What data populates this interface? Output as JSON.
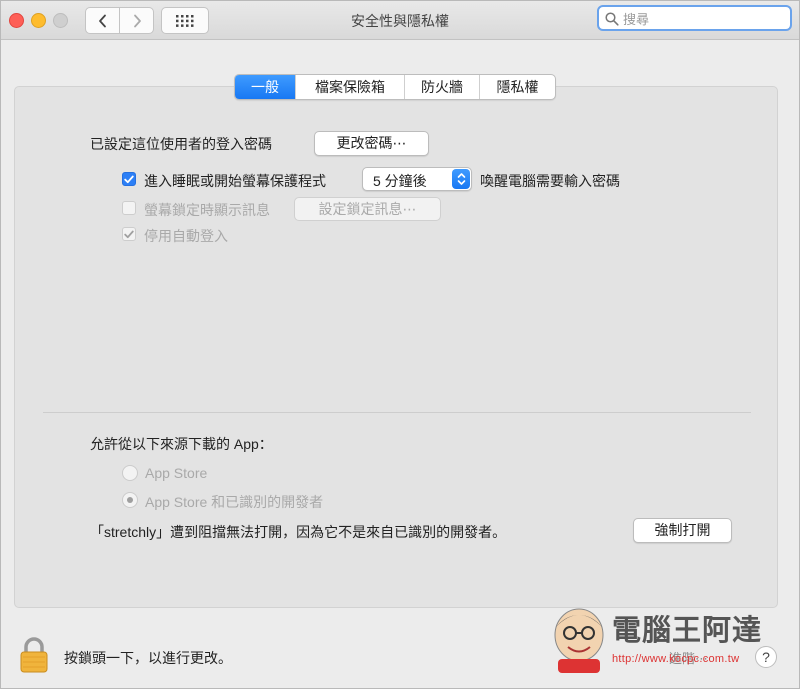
{
  "window": {
    "title": "安全性與隱私權",
    "search_placeholder": "搜尋"
  },
  "tabs": [
    {
      "label": "一般",
      "active": true
    },
    {
      "label": "檔案保險箱",
      "active": false
    },
    {
      "label": "防火牆",
      "active": false
    },
    {
      "label": "隱私權",
      "active": false
    }
  ],
  "general": {
    "password_set_text": "已設定這位使用者的登入密碼",
    "change_password_button": "更改密碼⋯",
    "require_password": {
      "checked": true,
      "label": "進入睡眠或開始螢幕保護程式",
      "delay_value": "5 分鐘後",
      "suffix": "喚醒電腦需要輸入密碼"
    },
    "show_message": {
      "checked": false,
      "enabled": false,
      "label": "螢幕鎖定時顯示訊息",
      "set_message_button": "設定鎖定訊息⋯"
    },
    "disable_auto_login": {
      "checked": true,
      "enabled": false,
      "label": "停用自動登入"
    },
    "allow_apps_title": "允許從以下來源下載的 App：",
    "app_sources": [
      {
        "label": "App Store",
        "selected": false
      },
      {
        "label": "App Store 和已識別的開發者",
        "selected": true
      }
    ],
    "blocked_message": "「stretchly」遭到阻擋無法打開，因為它不是來自已識別的開發者。",
    "open_anyway_button": "強制打開"
  },
  "footer": {
    "lock_text": "按鎖頭一下，以進行更改。",
    "advanced_label": "進階⋯",
    "help_label": "?"
  },
  "watermark": {
    "title": "電腦王阿達",
    "url": "http://www.kocpc.com.tw"
  },
  "colors": {
    "accent": "#1f7cf5",
    "close": "#fe5f57",
    "minimize": "#febc2e",
    "zoom": "#cfcfcf",
    "lock": "#f0b43c"
  }
}
